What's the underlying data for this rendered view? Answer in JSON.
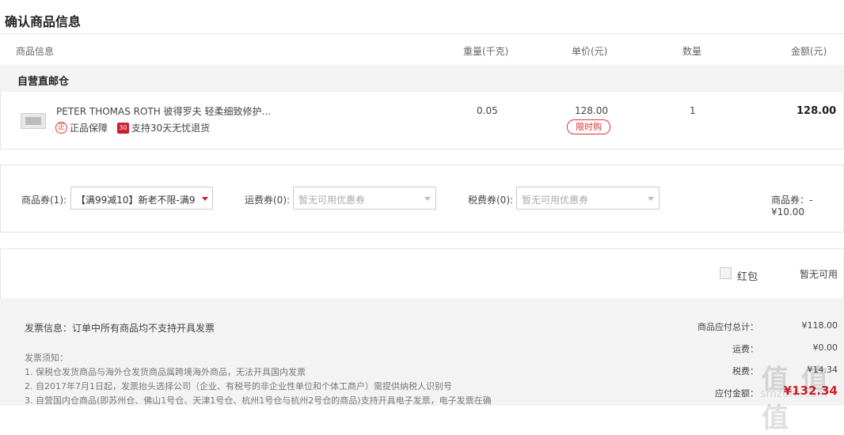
{
  "section_title": "确认商品信息",
  "columns": {
    "info": "商品信息",
    "weight": "重量(千克)",
    "unit_price": "单价(元)",
    "qty": "数量",
    "amount": "金额(元)"
  },
  "warehouse": "自营直邮仓",
  "item": {
    "name": "PETER THOMAS ROTH 彼得罗夫 轻柔细致修护...",
    "badge1_icon": "正",
    "badge1_text": "正品保障",
    "badge2_icon": "30",
    "badge2_text": "支持30天无忧退货",
    "weight": "0.05",
    "price": "128.00",
    "promo_tag": "限时购",
    "qty": "1",
    "amount": "128.00"
  },
  "coupons": {
    "goods_label": "商品券(1):",
    "goods_value": "【满99减10】新老不限-满9...",
    "shipping_label": "运费券(0):",
    "shipping_placeholder": "暂无可用优惠券",
    "tax_label": "税费券(0):",
    "tax_placeholder": "暂无可用优惠券",
    "discount_summary": "商品券：-¥10.00"
  },
  "red_packet": {
    "label": "红包",
    "status": "暂无可用"
  },
  "invoice": {
    "info": "发票信息：订单中所有商品均不支持开具发票",
    "notes_title": "发票须知：",
    "notes": [
      "1. 保税仓发货商品与海外仓发货商品属跨境海外商品，无法开具国内发票",
      "2. 自2017年7月1日起，发票抬头选择公司（企业、有税号的非企业性单位和个体工商户）需提供纳税人识别号",
      "3. 自营国内仓商品(即苏州仓、佛山1号仓、天津1号仓、杭州1号仓与杭州2号仓的商品)支持开具电子发票，电子发票在确"
    ]
  },
  "summary": {
    "subtotal_label": "商品应付总计：",
    "subtotal_value": "¥118.00",
    "shipping_label": "运费：",
    "shipping_value": "¥0.00",
    "tax_label": "税费：",
    "tax_value": "¥14.34",
    "total_label": "应付金额：",
    "total_value": "¥132.34"
  },
  "watermark": {
    "main": "值 值 值",
    "sub": "smzdm.com"
  },
  "colors": {
    "accent": "#d3202c",
    "footer_bg": "#f3f3f3",
    "border": "#e5e5e5"
  }
}
